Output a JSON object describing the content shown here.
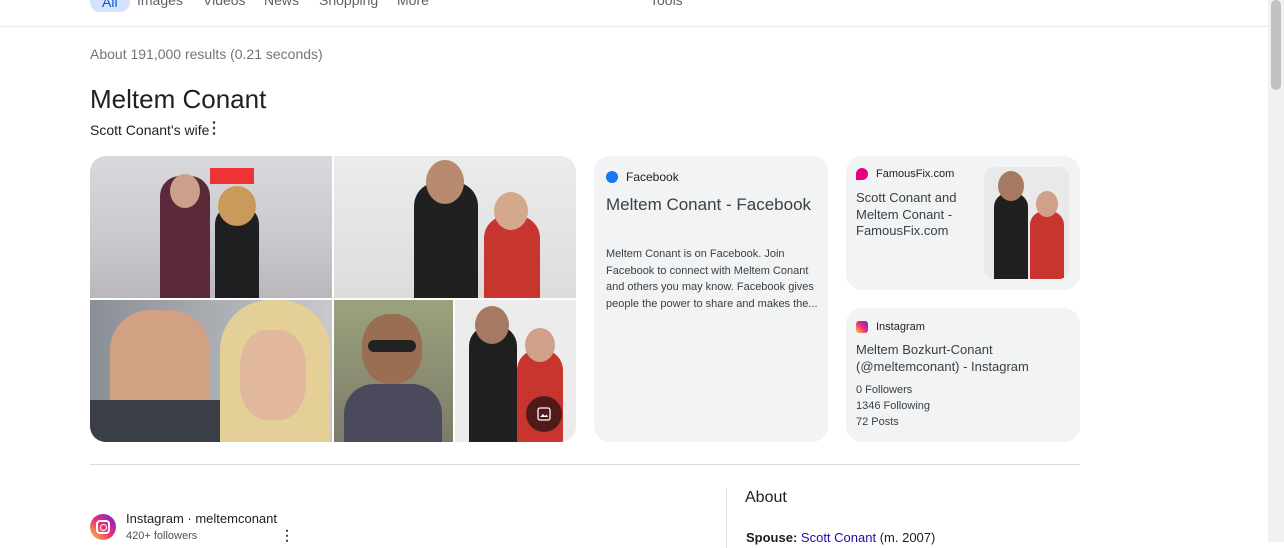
{
  "tabs": [
    {
      "label": "All"
    },
    {
      "label": "Images"
    },
    {
      "label": "Videos"
    },
    {
      "label": "News"
    },
    {
      "label": "Shopping"
    },
    {
      "label": "More"
    },
    {
      "label": "Tools"
    }
  ],
  "stats": "About 191,000 results (0.21 seconds)",
  "entity": {
    "title": "Meltem Conant",
    "subtitle": "Scott Conant's wife"
  },
  "cards": {
    "facebook": {
      "source": "Facebook",
      "title": "Meltem Conant - Facebook",
      "snippet": "Meltem Conant is on Facebook. Join Facebook to connect with Meltem Conant and others you may know. Facebook gives people the power to share and makes the..."
    },
    "famousfix": {
      "source": "FamousFix.com",
      "title": "Scott Conant and Meltem Conant - FamousFix.com"
    },
    "instagram": {
      "source": "Instagram",
      "title": "Meltem Bozkurt-Conant (@meltemconant) - Instagram",
      "followers": "0 Followers",
      "following": "1346 Following",
      "posts": "72 Posts"
    }
  },
  "result": {
    "source": "Instagram · meltemconant",
    "meta": "420+ followers"
  },
  "about": {
    "heading": "About",
    "spouse_label": "Spouse:",
    "spouse_link": "Scott Conant",
    "spouse_extra": "(m. 2007)"
  },
  "colors": {
    "link": "#1a0dab",
    "facebook": "#1877f2",
    "famousfix": "#e6007e"
  }
}
